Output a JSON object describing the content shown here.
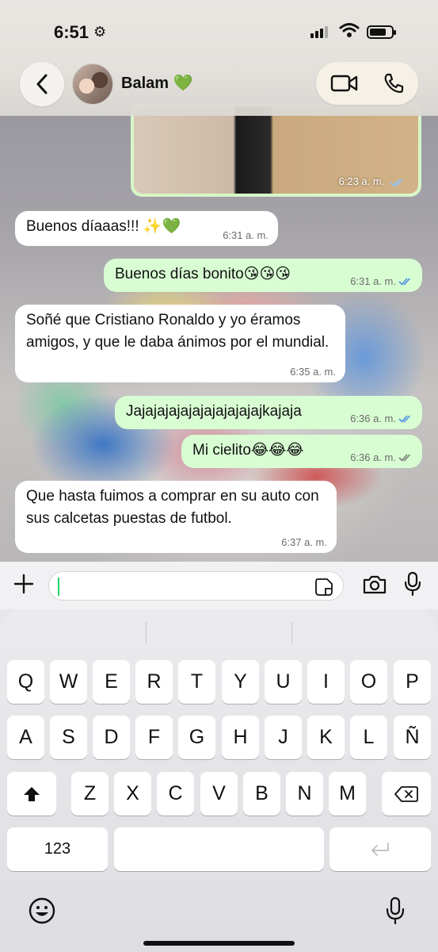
{
  "status_bar": {
    "time": "6:51",
    "time_icon": "gear-icon"
  },
  "header": {
    "contact_name": "Balam 💚",
    "icons": [
      "back-chevron-icon",
      "video-call-icon",
      "phone-call-icon"
    ]
  },
  "photo_message": {
    "time": "6:23 a. m.",
    "status": "read"
  },
  "messages": [
    {
      "direction": "in",
      "text": "Buenos díaaas!!! ✨💚",
      "time": "6:31 a. m."
    },
    {
      "direction": "out",
      "text": "Buenos días bonito😘😘😘",
      "time": "6:31 a. m.",
      "status": "read"
    },
    {
      "direction": "in",
      "text": "Soñé que Cristiano Ronaldo y yo éramos amigos, y que le daba ánimos por el mundial.",
      "time": "6:35 a. m."
    },
    {
      "direction": "out",
      "text": "Jajajajajajajajajajajajkajaja",
      "time": "6:36 a. m.",
      "status": "read"
    },
    {
      "direction": "out",
      "text": "Mi cielito😂😂😂",
      "time": "6:36 a. m.",
      "status": "delivered"
    },
    {
      "direction": "in",
      "text": "Que hasta fuimos a comprar en su auto con sus calcetas puestas de futbol.",
      "time": "6:37 a. m."
    }
  ],
  "input": {
    "value": "",
    "icons": [
      "plus-icon",
      "sticker-icon",
      "camera-icon",
      "microphone-icon"
    ]
  },
  "keyboard": {
    "row1": [
      "Q",
      "W",
      "E",
      "R",
      "T",
      "Y",
      "U",
      "I",
      "O",
      "P"
    ],
    "row2": [
      "A",
      "S",
      "D",
      "F",
      "G",
      "H",
      "J",
      "K",
      "L",
      "Ñ"
    ],
    "row3": [
      "Z",
      "X",
      "C",
      "V",
      "B",
      "N",
      "M"
    ],
    "numbers_label": "123",
    "icons": [
      "shift-icon",
      "delete-icon",
      "return-icon",
      "emoji-icon",
      "dictation-icon"
    ]
  },
  "colors": {
    "outgoing_bubble": "#d9fdd3",
    "incoming_bubble": "#ffffff",
    "read_ticks": "#4a8fe0",
    "caret": "#25d366"
  }
}
